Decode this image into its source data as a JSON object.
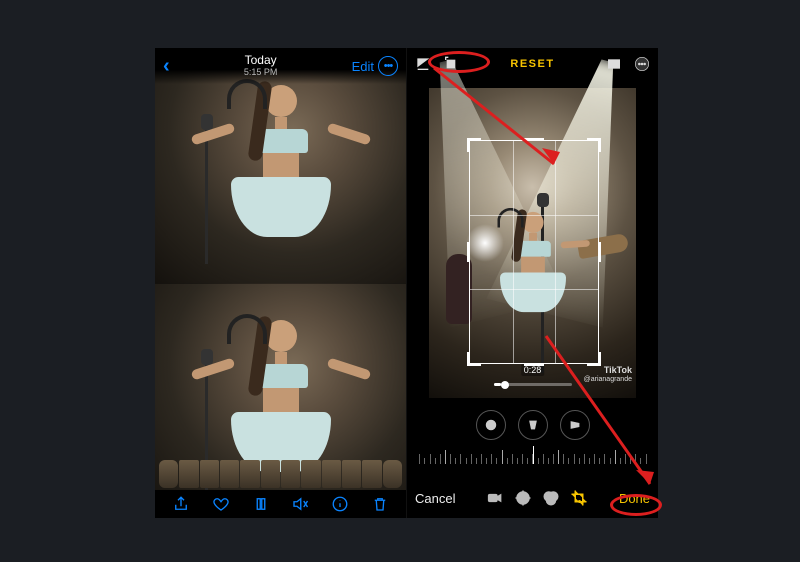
{
  "left": {
    "header": {
      "title": "Today",
      "subtitle": "5:15 PM",
      "edit": "Edit"
    },
    "watermark": {
      "brand": "TikTok",
      "handle": "@arianagrande"
    },
    "toolbar_icons": [
      "share",
      "favorite",
      "pause",
      "mute",
      "info",
      "trash"
    ]
  },
  "right": {
    "reset": "RESET",
    "video_time": "0:28",
    "watermark": {
      "brand": "TikTok",
      "handle": "@arianagrande"
    },
    "cancel": "Cancel",
    "done": "Done"
  }
}
